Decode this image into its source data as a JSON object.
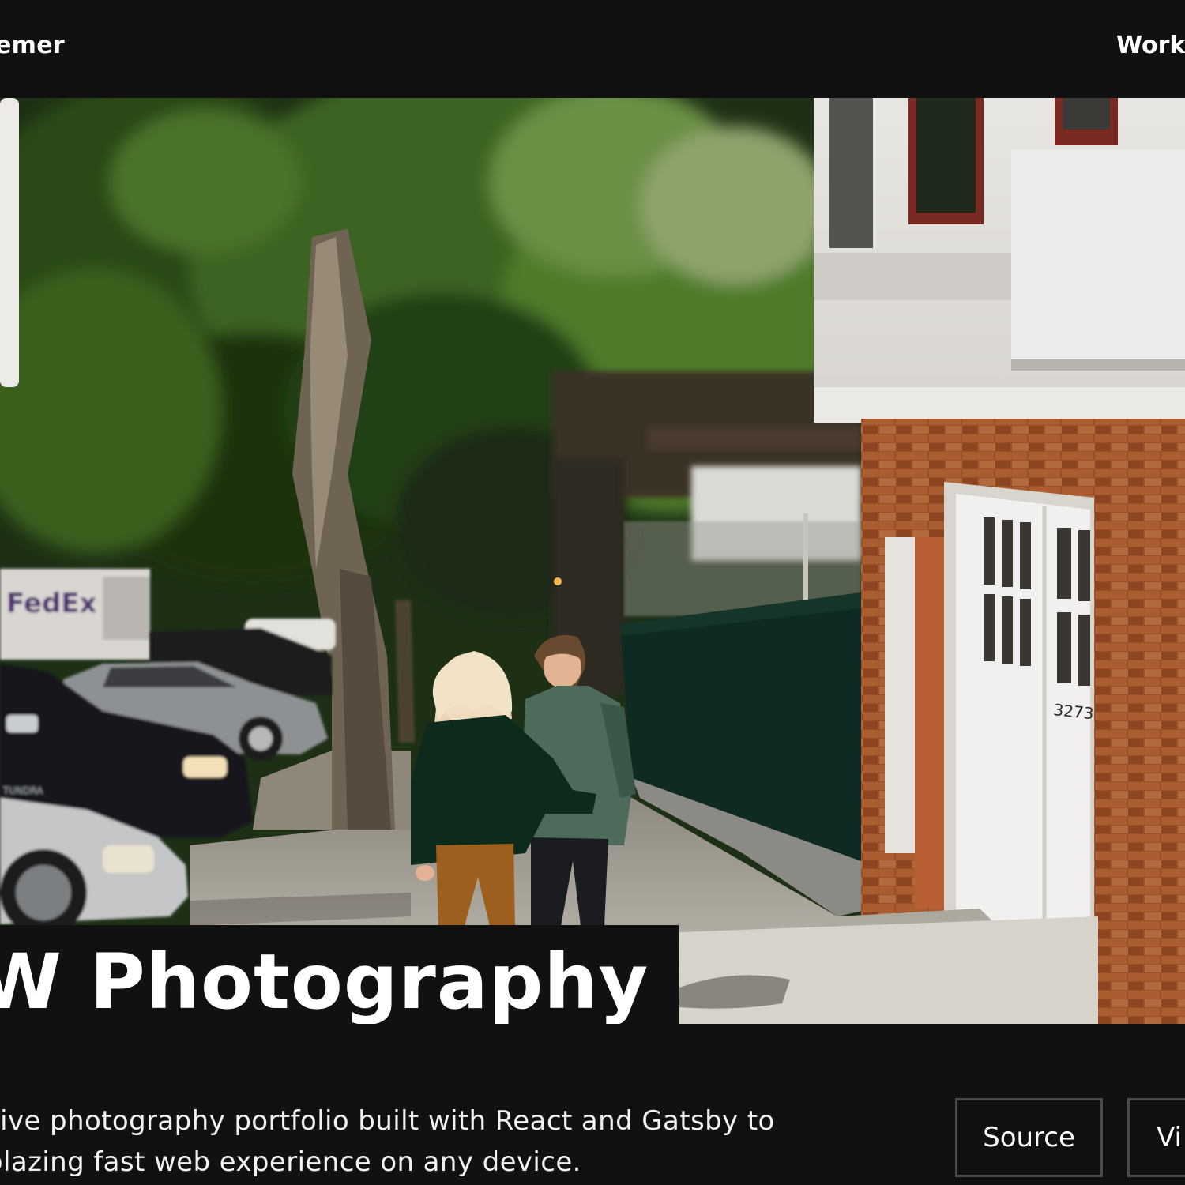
{
  "header": {
    "brand": "emer",
    "nav_work": "Work"
  },
  "hero": {
    "image_label": "Photograph of a couple walking down a tree-lined sidewalk",
    "sign_text": "FedEx",
    "truck_badge": "TUNDRA",
    "door_number": "3273"
  },
  "project": {
    "title": "W Photography",
    "description_line1": "sive photography portfolio built with React and Gatsby to",
    "description_line2": "blazing fast web experience on any device."
  },
  "actions": {
    "source_label": "Source",
    "view_label": "Vi"
  },
  "colors": {
    "background": "#111111",
    "text": "#ffffff",
    "button_border": "#4a4a4a"
  }
}
